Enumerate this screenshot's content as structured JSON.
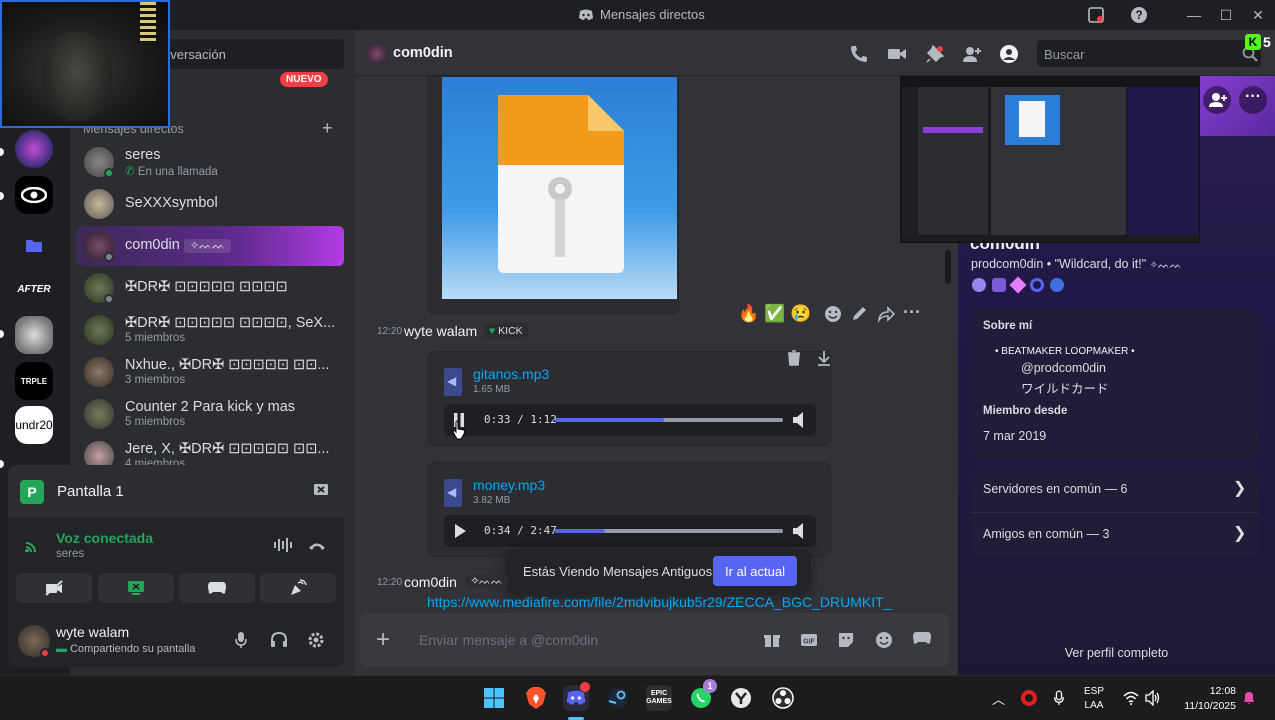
{
  "window": {
    "title": "Mensajes directos"
  },
  "sidebar": {
    "search_placeholder": "Inicia una conversación",
    "nuevo_badge": "NUEVO",
    "dm_header": "Mensajes directos",
    "items": [
      {
        "name": "seres",
        "sub": "En una llamada",
        "status_color": "#23a55a"
      },
      {
        "name": "SeXXXsymbol",
        "sub": ""
      },
      {
        "name": "com0din",
        "sub": "",
        "tag": "✧ᨓᨓ",
        "active": true
      },
      {
        "name": "✠DR✠ ⊡⊡⊡⊡⊡ ⊡⊡⊡⊡",
        "sub": ""
      },
      {
        "name": "✠DR✠ ⊡⊡⊡⊡⊡ ⊡⊡⊡⊡, SeX...",
        "sub": "5 miembros"
      },
      {
        "name": "Nxhue., ✠DR✠ ⊡⊡⊡⊡⊡ ⊡⊡...",
        "sub": "3 miembros"
      },
      {
        "name": "Counter 2 Para kick y mas",
        "sub": "5 miembros"
      },
      {
        "name": "Jere, X, ✠DR✠ ⊡⊡⊡⊡⊡ ⊡⊡...",
        "sub": "4 miembros"
      }
    ]
  },
  "rail": {
    "servers": [
      "AFTER",
      "undr20"
    ]
  },
  "voice": {
    "screen_label": "Pantalla 1",
    "screen_icon_letter": "P",
    "status": "Voz conectada",
    "channel": "seres"
  },
  "user": {
    "name": "wyte walam",
    "status": "Compartiendo su pantalla"
  },
  "chat": {
    "header_name": "com0din",
    "search_placeholder": "Buscar",
    "kick_count": "5",
    "reactions": [
      "🔥",
      "✅",
      "😢"
    ],
    "messages": [
      {
        "time": "12:20",
        "author": "wyte walam",
        "badge": "KICK",
        "files": [
          {
            "name": "gitanos.mp3",
            "size": "1.65 MB",
            "time": "0:33 / 1:12",
            "progress": 0.48
          },
          {
            "name": "money.mp3",
            "size": "3.82 MB",
            "time": "0:34 / 2:47",
            "progress": 0.22
          }
        ]
      },
      {
        "time": "12:20",
        "author": "com0din",
        "link": "https://www.mediafire.com/file/2mdvibujkub5r29/ZECCA_BGC_DRUMKIT_"
      }
    ],
    "old_messages_notice": "Estás Viendo Mensajes Antiguos",
    "jump_button": "Ir al actual",
    "composer_placeholder": "Enviar mensaje a @com0din"
  },
  "profile": {
    "display_name": "com0din",
    "username": "prodcom0din",
    "tagline": "\"Wildcard, do it!\"",
    "about_title": "Sobre mí",
    "about_line1": "• BEATMAKER  LOOPMAKER •",
    "about_line2": "@prodcom0din",
    "about_line3": "ワイルドカード",
    "member_since_title": "Miembro desde",
    "member_since": "7 mar 2019",
    "servers_common": "Servidores en común — 6",
    "friends_common": "Amigos en común — 3",
    "full_profile": "Ver perfil completo"
  },
  "taskbar": {
    "lang1": "ESP",
    "lang2": "LAA",
    "time": "12:08",
    "date": "11/10/2025",
    "discord_badge": "1"
  }
}
